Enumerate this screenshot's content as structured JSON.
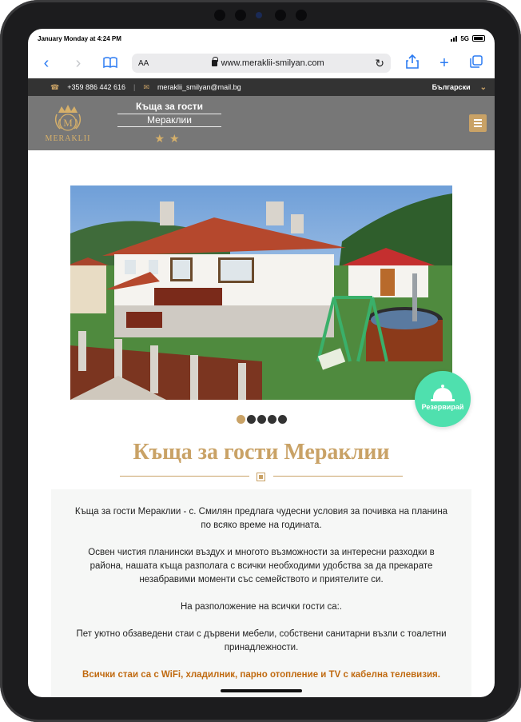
{
  "status_bar": {
    "time": "January Monday at 4:24 PM",
    "network": "5G"
  },
  "browser": {
    "text_size_label": "AA",
    "url": "www.meraklii-smilyan.com",
    "icons": [
      "back-icon",
      "forward-icon",
      "book-icon",
      "reload-icon",
      "share-icon",
      "plus-icon",
      "tabs-icon"
    ]
  },
  "topbar": {
    "phone": "+359 886 442 616",
    "separator": "|",
    "email": "meraklii_smilyan@mail.bg",
    "language": "Български"
  },
  "header": {
    "logo_text": "MERAKLII",
    "logo_letter": "M",
    "title_line1": "Къща за гости",
    "title_line2": "Мераклии",
    "stars": "★★"
  },
  "slider": {
    "slide_count": 5,
    "active_slide": 1
  },
  "reserve_button": {
    "label": "Резервирай"
  },
  "main": {
    "title": "Къща за гости Мераклии",
    "paragraphs": [
      "Къща за гости Мераклии - с. Смилян предлага чудесни условия за почивка на планина по всяко време на годината.",
      "Освен чистия планински въздух и многото възможности за интересни разходки в района, нашата къща разполага с всички необходими удобства за да прекарате незабравими моменти със семейството и приятелите си.",
      "На разположение на всички гости са:.",
      "Пет уютно обзаведени стаи с дървени мебели, собствени санитарни възли с тоалетни принадлежности."
    ],
    "highlight": "Всички стаи са с WiFi, хладилник, парно отопление и TV с кабелна телевизия."
  },
  "colors": {
    "accent_gold": "#c9a266",
    "reserve_green": "#4fe0ae",
    "topbar_bg": "#333333",
    "header_bg": "#777777",
    "highlight_orange": "#c06a10"
  }
}
